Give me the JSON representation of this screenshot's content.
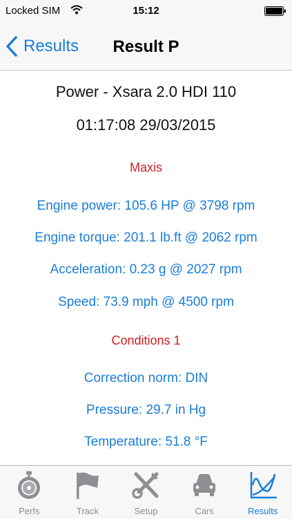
{
  "status_bar": {
    "carrier": "Locked SIM",
    "time": "15:12"
  },
  "nav": {
    "back_label": "Results",
    "title": "Result P"
  },
  "header": {
    "line1": "Power - Xsara 2.0 HDI 110",
    "line2": "01:17:08 29/03/2015"
  },
  "sections": {
    "maxis": {
      "title": "Maxis",
      "rows": [
        "Engine power: 105.6 HP @ 3798 rpm",
        "Engine torque: 201.1 lb.ft @ 2062 rpm",
        "Acceleration: 0.23 g @ 2027 rpm",
        "Speed: 73.9 mph @ 4500 rpm"
      ]
    },
    "conditions": {
      "title": "Conditions 1",
      "rows": [
        "Correction norm: DIN",
        "Pressure: 29.7 in Hg",
        "Temperature: 51.8 °F"
      ]
    }
  },
  "tabs": [
    {
      "label": "Perfs",
      "icon": "stopwatch-icon"
    },
    {
      "label": "Track",
      "icon": "flag-icon"
    },
    {
      "label": "Setup",
      "icon": "tools-icon"
    },
    {
      "label": "Cars",
      "icon": "car-icon"
    },
    {
      "label": "Results",
      "icon": "chart-icon",
      "active": true
    }
  ],
  "colors": {
    "accent": "#1a7dd8",
    "section_red": "#cc1f1f",
    "inactive_tab": "#8e8e93"
  }
}
